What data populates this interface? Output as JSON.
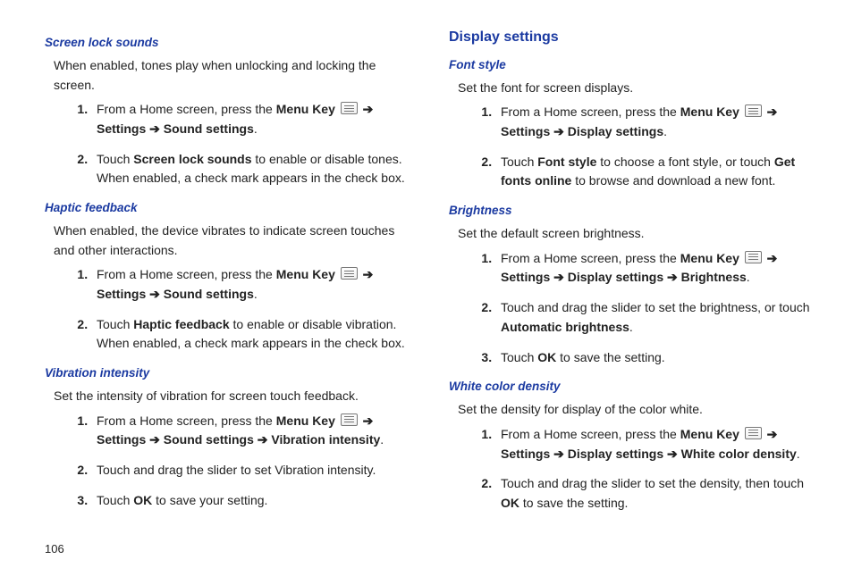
{
  "pageNumber": "106",
  "left": {
    "s1": {
      "title": "Screen lock sounds",
      "intro": "When enabled, tones play when unlocking and locking the screen.",
      "step1_a": "From a Home screen, press the ",
      "step1_menukey": "Menu Key",
      "step1_arrow1": " ➔ ",
      "step1_settings": "Settings",
      "step1_arrow2": " ➔ ",
      "step1_sound": "Sound settings",
      "step1_end": ".",
      "step2_a": "Touch ",
      "step2_b": "Screen lock sounds",
      "step2_c": " to enable or disable tones. When enabled, a check mark appears in the check box."
    },
    "s2": {
      "title": "Haptic feedback",
      "intro": "When enabled, the device vibrates to indicate screen touches and other interactions.",
      "step1_a": "From a Home screen, press the ",
      "step1_menukey": "Menu Key",
      "step1_arrow1": " ➔ ",
      "step1_settings": "Settings",
      "step1_arrow2": " ➔ ",
      "step1_sound": "Sound settings",
      "step1_end": ".",
      "step2_a": "Touch ",
      "step2_b": "Haptic feedback",
      "step2_c": " to enable or disable vibration. When enabled, a check mark appears in the check box."
    },
    "s3": {
      "title": "Vibration intensity",
      "intro": "Set the intensity of vibration for screen touch feedback.",
      "step1_a": "From a Home screen, press the ",
      "step1_menukey": "Menu Key",
      "step1_arrow1": " ➔ ",
      "step1_settings": "Settings",
      "step1_arrow2": " ➔ ",
      "step1_sound": "Sound settings",
      "step1_arrow3": " ➔ ",
      "step1_vib": "Vibration intensity",
      "step1_end": ".",
      "step2": "Touch and drag the slider to set Vibration intensity.",
      "step3_a": "Touch ",
      "step3_b": "OK",
      "step3_c": "  to save your setting."
    }
  },
  "right": {
    "header": "Display settings",
    "s1": {
      "title": "Font style",
      "intro": "Set the font for screen displays.",
      "step1_a": "From a Home screen, press the ",
      "step1_menukey": "Menu Key",
      "step1_arrow1": " ➔ ",
      "step1_settings": "Settings",
      "step1_arrow2": " ➔ ",
      "step1_display": "Display settings",
      "step1_end": ".",
      "step2_a": "Touch ",
      "step2_b": "Font style",
      "step2_c": " to choose a font style, or touch ",
      "step2_d": "Get fonts online",
      "step2_e": " to browse and download a new font."
    },
    "s2": {
      "title": "Brightness",
      "intro": "Set the default screen brightness.",
      "step1_a": "From a Home screen, press the ",
      "step1_menukey": "Menu Key",
      "step1_arrow1": " ➔ ",
      "step1_settings": "Settings",
      "step1_arrow2": " ➔ ",
      "step1_display": "Display settings",
      "step1_arrow3": " ➔ ",
      "step1_bright": "Brightness",
      "step1_end": ".",
      "step2_a": "Touch and drag the slider to set the brightness, or touch ",
      "step2_b": "Automatic brightness",
      "step2_c": ".",
      "step3_a": "Touch ",
      "step3_b": "OK",
      "step3_c": " to save the setting."
    },
    "s3": {
      "title": "White color density",
      "intro": "Set the density for display of the color white.",
      "step1_a": "From a Home screen, press the ",
      "step1_menukey": "Menu Key",
      "step1_arrow1": " ➔ ",
      "step1_settings": "Settings",
      "step1_arrow2": " ➔ ",
      "step1_display": "Display settings",
      "step1_arrow3": " ➔ ",
      "step1_white": "White color density",
      "step1_end": ".",
      "step2_a": "Touch and drag the slider to set the density, then touch ",
      "step2_b": "OK",
      "step2_c": " to save the setting."
    }
  }
}
